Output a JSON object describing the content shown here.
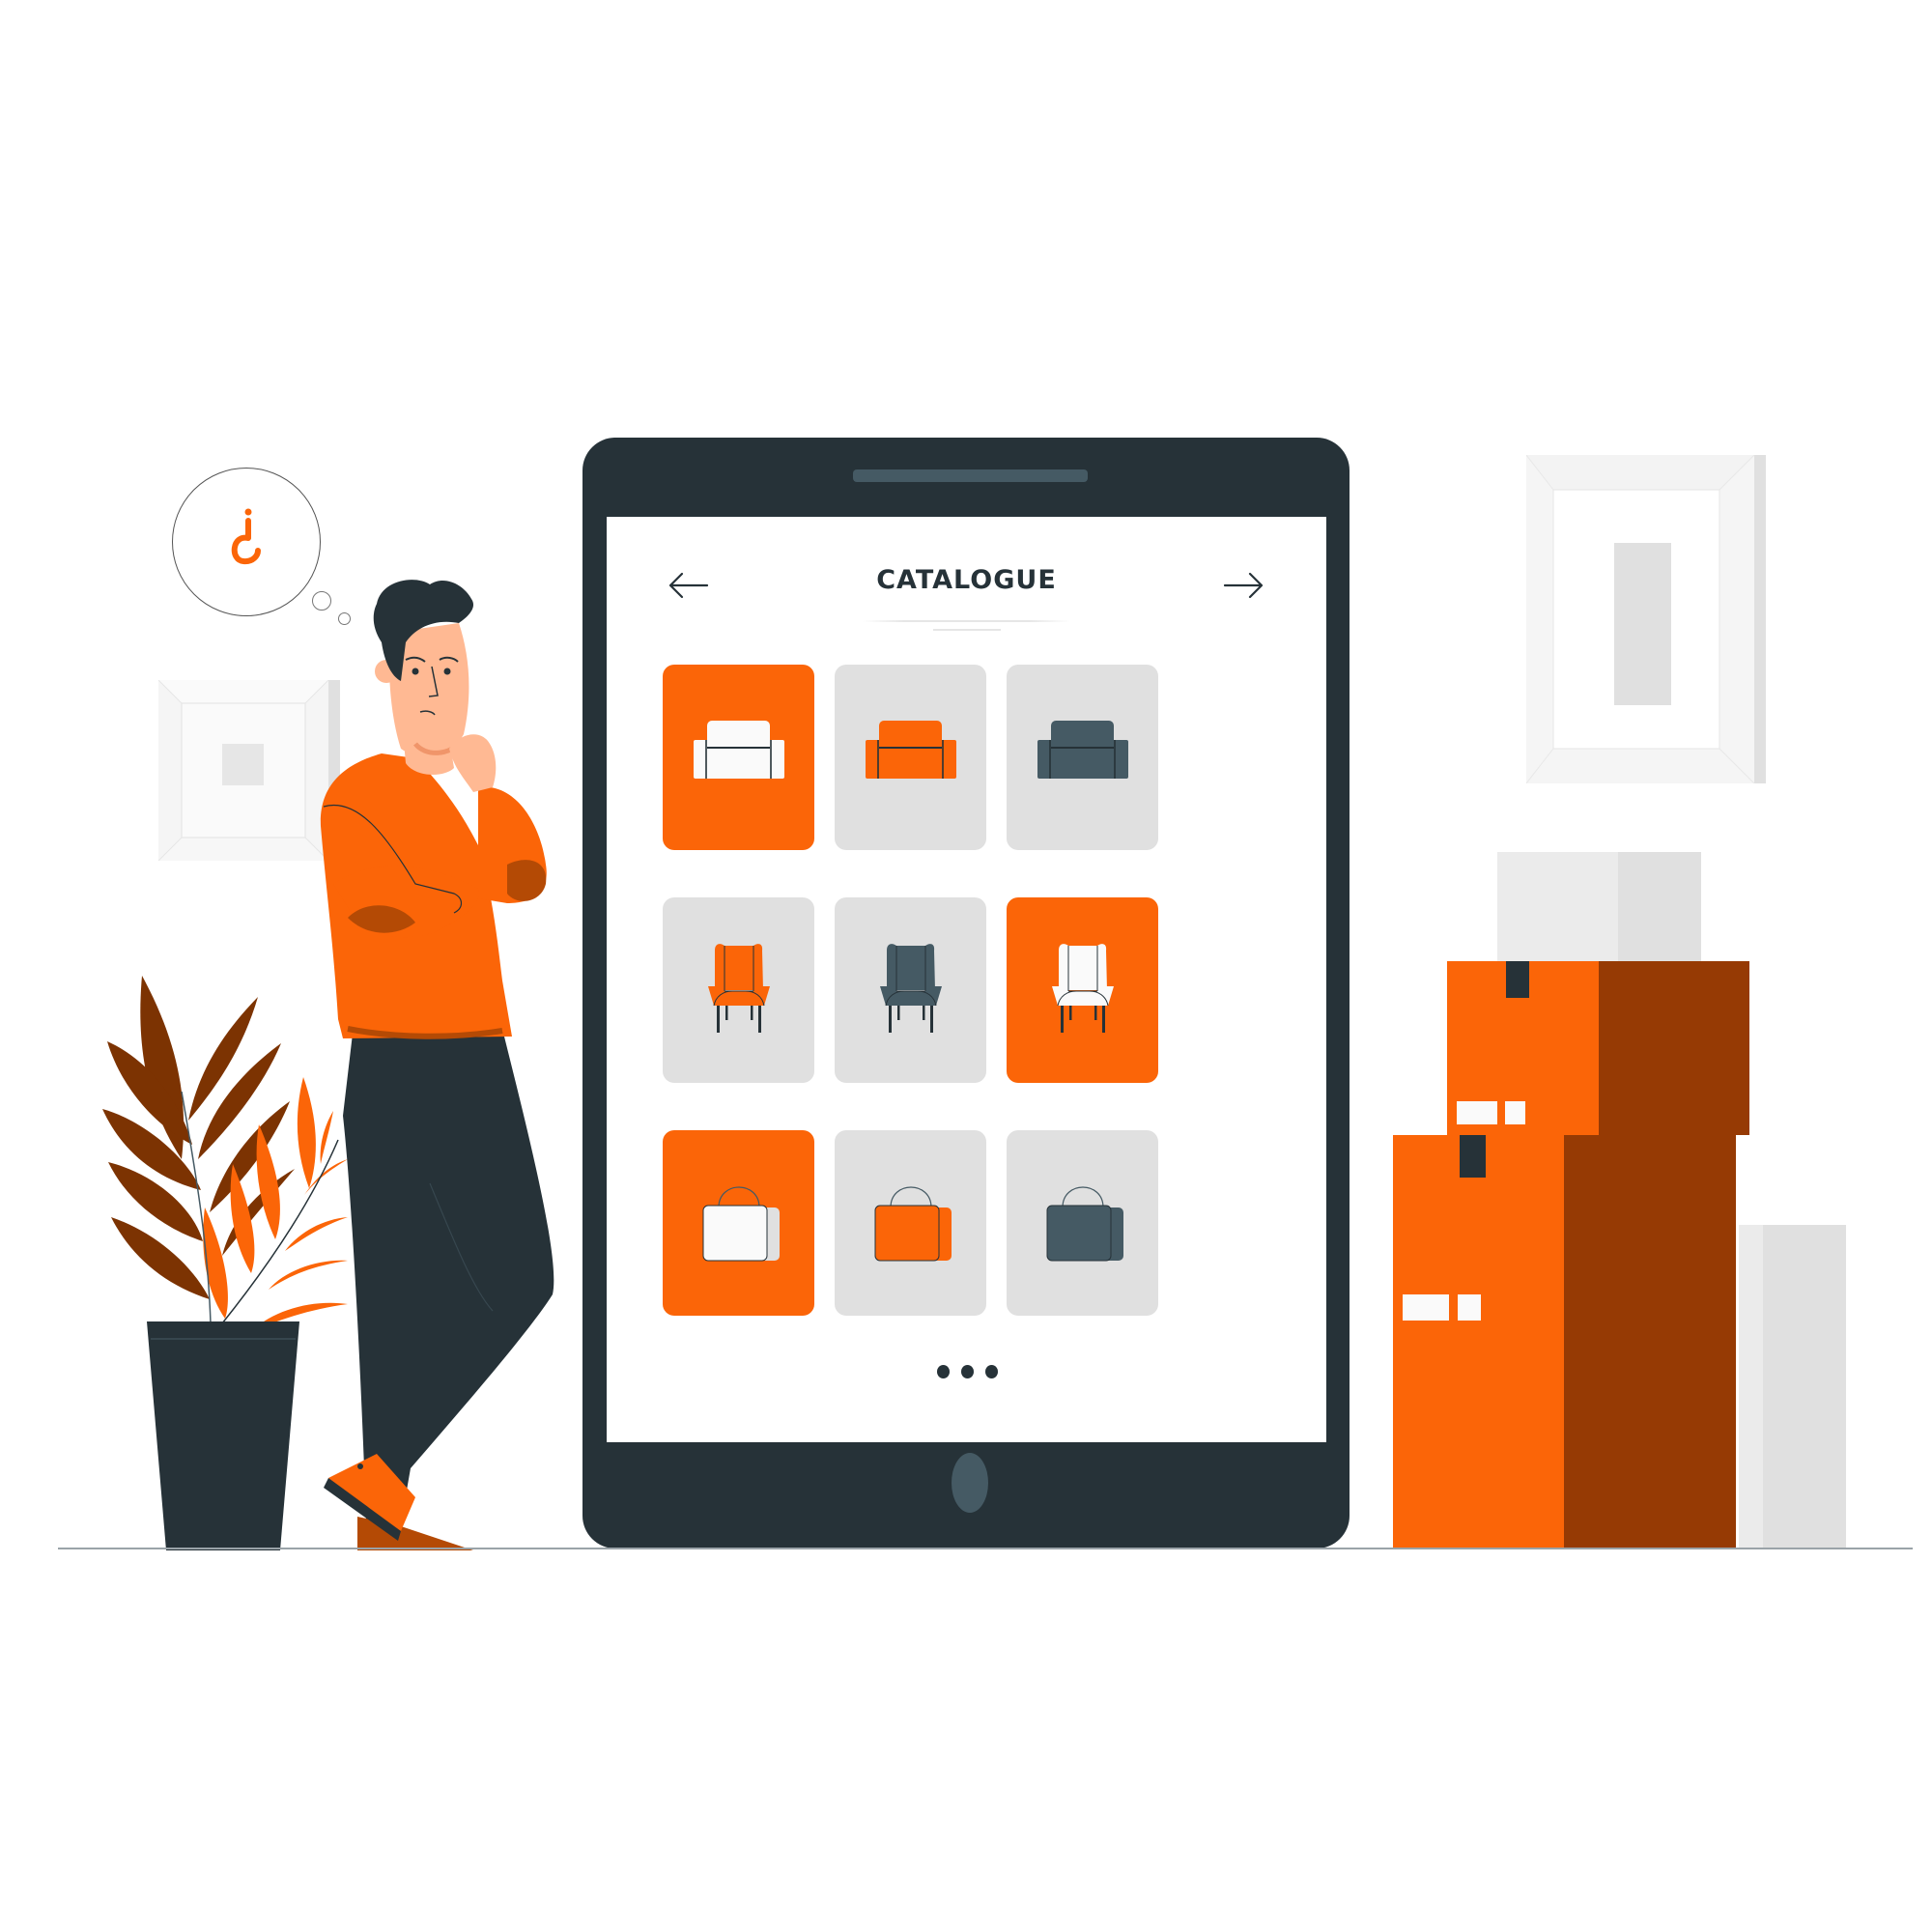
{
  "scene": {
    "description": "Person thinking in front of a large phone showing a product catalogue",
    "colors": {
      "accent": "#fb6508",
      "accent_dark": "#b44a05",
      "box_shadow": "#963a04",
      "plant_dark": "#7c3302",
      "dark": "#263238",
      "slate": "#455a64",
      "tile_gray": "#e0e0e0",
      "off_white": "#fafafa",
      "skin": "#ffb993",
      "wall_light": "#f5f5f5"
    },
    "thought_bubble": {
      "icon": "question-mark-icon"
    }
  },
  "phone": {
    "header": {
      "title": "CATALOGUE",
      "prev_icon": "arrow-left-icon",
      "next_icon": "arrow-right-icon"
    },
    "catalogue": {
      "rows": [
        {
          "category": "sofa",
          "items": [
            {
              "product": "sofa",
              "color": "white",
              "selected": true
            },
            {
              "product": "sofa",
              "color": "orange",
              "selected": false
            },
            {
              "product": "sofa",
              "color": "slate",
              "selected": false
            }
          ]
        },
        {
          "category": "armchair",
          "items": [
            {
              "product": "armchair",
              "color": "orange",
              "selected": false
            },
            {
              "product": "armchair",
              "color": "slate",
              "selected": false
            },
            {
              "product": "armchair",
              "color": "white",
              "selected": true
            }
          ]
        },
        {
          "category": "bag",
          "items": [
            {
              "product": "bag",
              "color": "white",
              "selected": true
            },
            {
              "product": "bag",
              "color": "orange",
              "selected": false
            },
            {
              "product": "bag",
              "color": "slate",
              "selected": false
            }
          ]
        }
      ]
    },
    "more_indicator": {
      "icon": "more-dots-icon",
      "count": 3
    },
    "home_button": {
      "icon": "home-button-icon"
    }
  }
}
